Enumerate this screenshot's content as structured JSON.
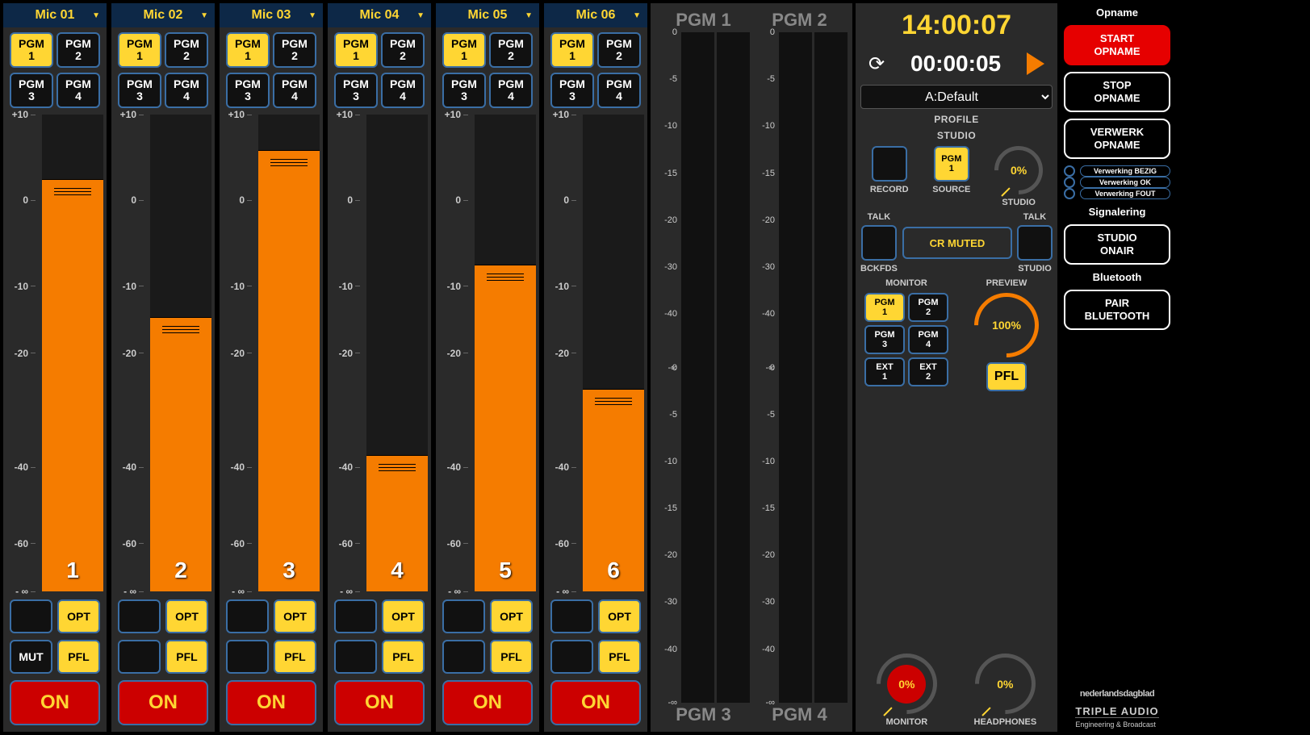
{
  "channels": [
    {
      "name": "Mic 01",
      "fader_pct": 84,
      "number": "1",
      "mut": true
    },
    {
      "name": "Mic 02",
      "fader_pct": 55,
      "number": "2",
      "mut": false
    },
    {
      "name": "Mic 03",
      "fader_pct": 90,
      "number": "3",
      "mut": false
    },
    {
      "name": "Mic 04",
      "fader_pct": 26,
      "number": "4",
      "mut": false
    },
    {
      "name": "Mic 05",
      "fader_pct": 66,
      "number": "5",
      "mut": false
    },
    {
      "name": "Mic 06",
      "fader_pct": 40,
      "number": "6",
      "mut": false
    }
  ],
  "pgm_labels": {
    "pgm1_a": "PGM",
    "pgm1_b": "1",
    "pgm2_a": "PGM",
    "pgm2_b": "2",
    "pgm3_a": "PGM",
    "pgm3_b": "3",
    "pgm4_a": "PGM",
    "pgm4_b": "4"
  },
  "scale_ticks": [
    {
      "label": "+10",
      "pos": 0
    },
    {
      "label": "0",
      "pos": 18
    },
    {
      "label": "-10",
      "pos": 36
    },
    {
      "label": "-20",
      "pos": 50
    },
    {
      "label": "-40",
      "pos": 74
    },
    {
      "label": "-60",
      "pos": 90
    },
    {
      "label": "- ∞",
      "pos": 100
    }
  ],
  "channel_buttons": {
    "opt": "OPT",
    "mut": "MUT",
    "pfl": "PFL",
    "on": "ON"
  },
  "meters": {
    "top_labels": [
      "PGM 1",
      "PGM 2"
    ],
    "bottom_labels": [
      "PGM 3",
      "PGM 4"
    ],
    "scale_top": [
      {
        "label": "0",
        "pos": 0
      },
      {
        "label": "-5",
        "pos": 14
      },
      {
        "label": "-10",
        "pos": 28
      },
      {
        "label": "-15",
        "pos": 42
      },
      {
        "label": "-20",
        "pos": 56
      },
      {
        "label": "-30",
        "pos": 70
      },
      {
        "label": "-40",
        "pos": 84
      },
      {
        "label": "-∞",
        "pos": 100
      }
    ],
    "scale_bottom": [
      {
        "label": "0",
        "pos": 0
      },
      {
        "label": "-5",
        "pos": 14
      },
      {
        "label": "-10",
        "pos": 28
      },
      {
        "label": "-15",
        "pos": 42
      },
      {
        "label": "-20",
        "pos": 56
      },
      {
        "label": "-30",
        "pos": 70
      },
      {
        "label": "-40",
        "pos": 84
      },
      {
        "label": "-∞",
        "pos": 100
      }
    ]
  },
  "monitor": {
    "clock": "14:00:07",
    "timer": "00:00:05",
    "profile_label": "PROFILE",
    "profile_value": "A:Default",
    "studio_label": "STUDIO",
    "record_label": "RECORD",
    "source_label": "SOURCE",
    "studio_knob_label": "STUDIO",
    "studio_knob_value": "0%",
    "talk_label": "TALK",
    "bckfds_label": "BCKFDS",
    "cr_muted": "CR MUTED",
    "studio2_label": "STUDIO",
    "monitor_label": "MONITOR",
    "preview_label": "PREVIEW",
    "preview_value": "100%",
    "pgm_btns": [
      {
        "a": "PGM",
        "b": "1",
        "active": true
      },
      {
        "a": "PGM",
        "b": "2",
        "active": false
      },
      {
        "a": "PGM",
        "b": "3",
        "active": false
      },
      {
        "a": "PGM",
        "b": "4",
        "active": false
      },
      {
        "a": "EXT",
        "b": "1",
        "active": false
      },
      {
        "a": "EXT",
        "b": "2",
        "active": false
      }
    ],
    "pfl_label": "PFL",
    "monitor_knob_value": "0%",
    "monitor_knob_label": "MONITOR",
    "headphones_value": "0%",
    "headphones_label": "HEADPHONES"
  },
  "sidebar": {
    "opname_title": "Opname",
    "start_a": "START",
    "start_b": "OPNAME",
    "stop_a": "STOP",
    "stop_b": "OPNAME",
    "verwerk_a": "VERWERK",
    "verwerk_b": "OPNAME",
    "status": [
      {
        "label": "Verwerking BEZIG"
      },
      {
        "label": "Verwerking OK"
      },
      {
        "label": "Verwerking FOUT"
      }
    ],
    "signalering_title": "Signalering",
    "studio_a": "STUDIO",
    "studio_b": "ONAIR",
    "bluetooth_title": "Bluetooth",
    "pair_a": "PAIR",
    "pair_b": "BLUETOOTH",
    "logo1": "nederlandsdagblad",
    "logo2_a": "TRIPLE AUDIO",
    "logo2_b": "Engineering & Broadcast"
  }
}
